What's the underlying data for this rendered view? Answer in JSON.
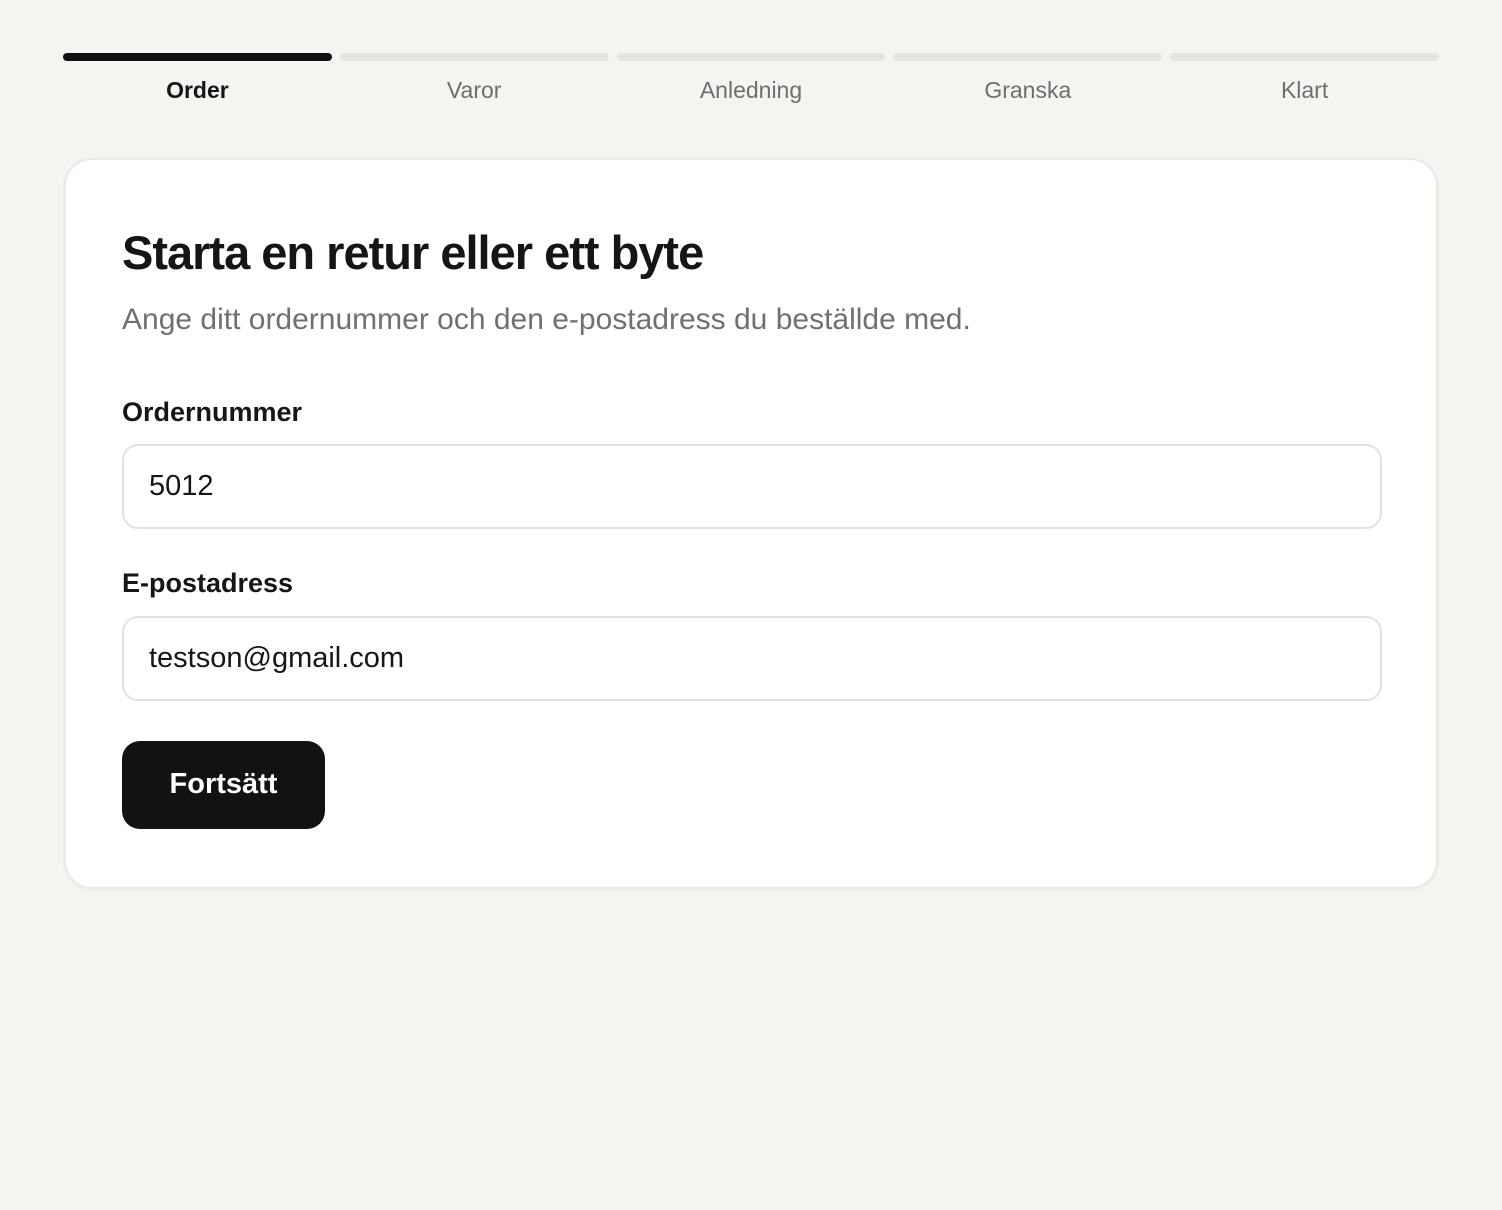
{
  "stepper": {
    "steps": [
      {
        "label": "Order",
        "active": true
      },
      {
        "label": "Varor",
        "active": false
      },
      {
        "label": "Anledning",
        "active": false
      },
      {
        "label": "Granska",
        "active": false
      },
      {
        "label": "Klart",
        "active": false
      }
    ]
  },
  "form": {
    "title": "Starta en retur eller ett byte",
    "subtitle": "Ange ditt ordernummer och den e-postadress du beställde med.",
    "order_number": {
      "label": "Ordernummer",
      "value": "5012"
    },
    "email": {
      "label": "E-postadress",
      "value": "testson@gmail.com"
    },
    "continue_label": "Fortsätt"
  },
  "colors": {
    "background": "#f4f4f0",
    "card": "#ffffff",
    "accent": "#121212",
    "inactive_step": "#e5e5e0",
    "muted_text": "#707070"
  }
}
